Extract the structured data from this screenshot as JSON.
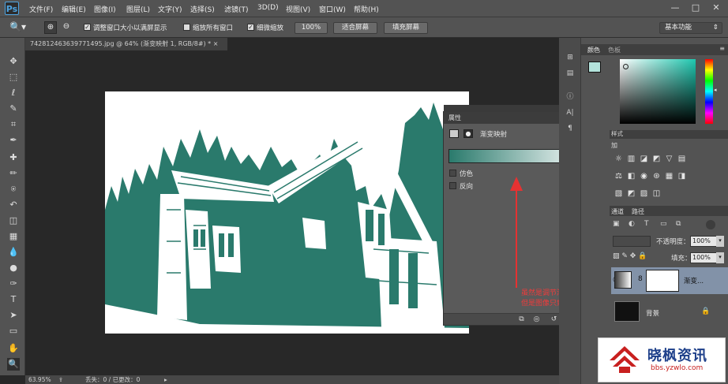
{
  "app": {
    "logo": "Ps"
  },
  "menu": [
    "文件(F)",
    "编辑(E)",
    "图像(I)",
    "图层(L)",
    "文字(Y)",
    "选择(S)",
    "滤镜(T)",
    "3D(D)",
    "视图(V)",
    "窗口(W)",
    "帮助(H)"
  ],
  "window_controls": {
    "minimize": "—",
    "restore": "□",
    "close": "✕"
  },
  "options": {
    "chk_resize_label": "调整窗口大小以满屏显示",
    "chk_zoom_all_label": "缩放所有窗口",
    "chk_scrubby_label": "细微缩放",
    "zoom100": "100%",
    "fit_screen": "适合屏幕",
    "fill_screen": "填充屏幕",
    "workspace": "基本功能"
  },
  "document": {
    "tab_title": "742812463639771495.jpg @ 64% (渐变映射 1, RGB/8#) *",
    "tab_close": "×",
    "status_zoom": "63.95%",
    "status_text": "丢失：0 / 已更改：0"
  },
  "properties": {
    "tab": "属性",
    "title": "渐变映射",
    "dither_label": "仿色",
    "reverse_label": "反向",
    "gradient_start_color": "#2a7a6c",
    "gradient_end_color": "#ffffff"
  },
  "annotation": {
    "line1": "虽然是调节渐变，",
    "line2": "但是图像只剩黑白两色"
  },
  "color_panel": {
    "tab_color": "颜色",
    "tab_swatches": "色板",
    "fg_color": "#b4e3dc",
    "hue_color": "#1fc8b0"
  },
  "adjustments": {
    "tab": "样式",
    "header": "加"
  },
  "layers": {
    "tab_channels": "通道",
    "tab_paths": "路径",
    "opacity_label": "不透明度：",
    "opacity_value": "100%",
    "fill_label": "填充：",
    "fill_value": "100%",
    "layer1_name": "渐变...",
    "layer2_name": "背景"
  },
  "watermark": {
    "title": "晓枫资讯",
    "url": "bbs.yzwlo.com"
  }
}
